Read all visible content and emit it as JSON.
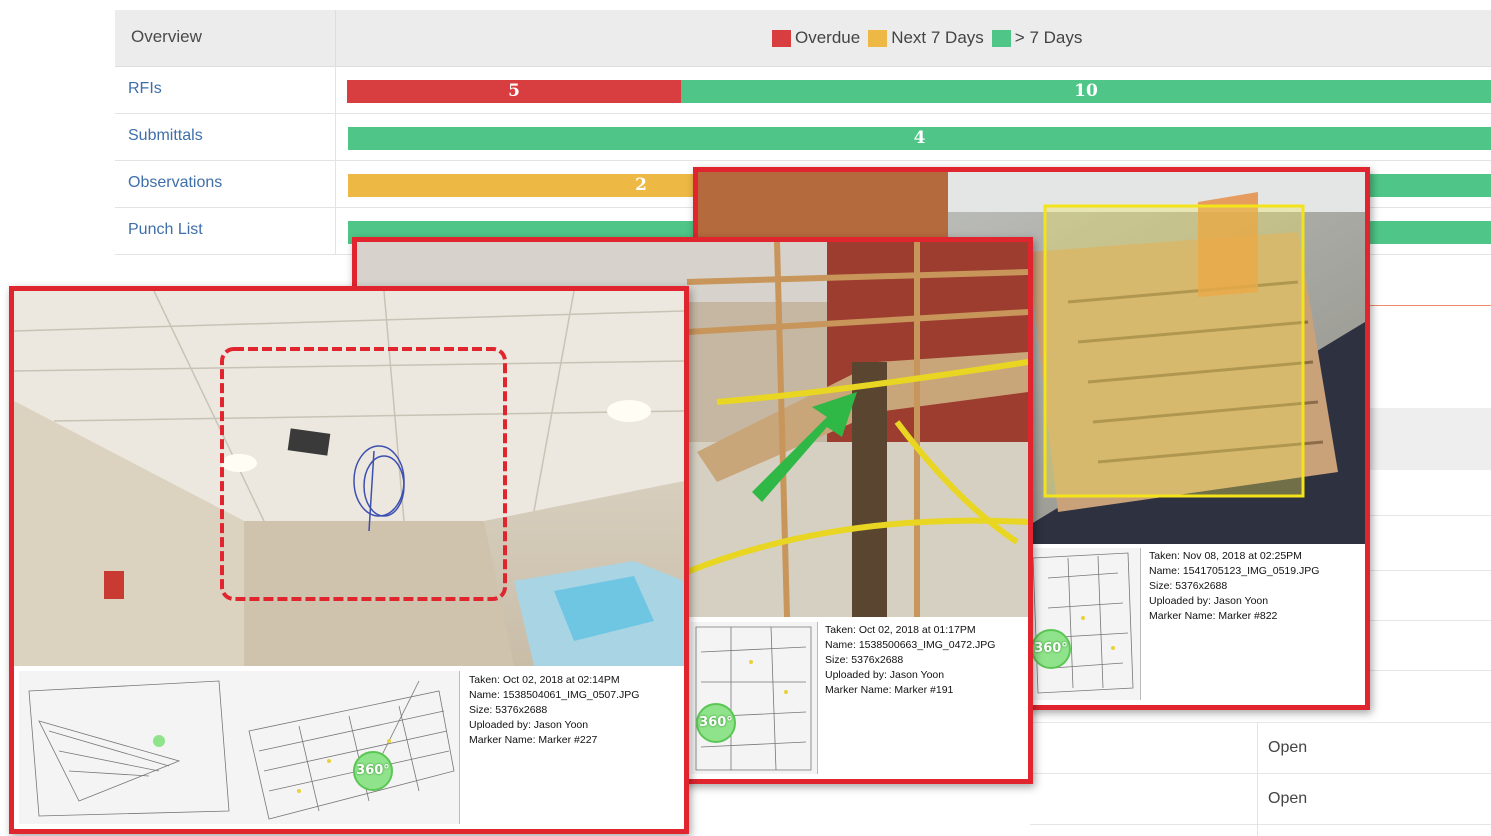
{
  "overview": {
    "title": "Overview",
    "legend": [
      {
        "label": "Overdue",
        "color": "#d83d3f"
      },
      {
        "label": "Next 7 Days",
        "color": "#eeb845"
      },
      {
        "label": "> 7 Days",
        "color": "#4fc687"
      }
    ],
    "rows": [
      {
        "label": "RFIs",
        "overdue": "5",
        "next7": "",
        "later": "10"
      },
      {
        "label": "Submittals",
        "overdue": "",
        "next7": "",
        "later": "4"
      },
      {
        "label": "Observations",
        "overdue": "",
        "next7": "2",
        "later": ""
      },
      {
        "label": "Punch List",
        "overdue": "",
        "next7": "",
        "later": ""
      }
    ]
  },
  "background_table": {
    "status_cells": [
      "Open",
      "Open"
    ]
  },
  "photos": [
    {
      "taken": "Taken: Oct 02, 2018 at 02:14PM",
      "name": "Name: 1538504061_IMG_0507.JPG",
      "size": "Size: 5376x2688",
      "uploaded_by": "Uploaded by: Jason Yoon",
      "marker": "Marker Name: Marker #227",
      "badge": "360°",
      "annotation": "red-cloud"
    },
    {
      "taken": "Taken: Oct 02, 2018 at 01:17PM",
      "name": "Name: 1538500663_IMG_0472.JPG",
      "size": "Size: 5376x2688",
      "uploaded_by": "Uploaded by: Jason Yoon",
      "marker": "Marker Name: Marker #191",
      "badge": "360°",
      "annotation": "green-arrow"
    },
    {
      "taken": "Taken: Nov 08, 2018 at 02:25PM",
      "name": "Name: 1541705123_IMG_0519.JPG",
      "size": "Size: 5376x2688",
      "uploaded_by": "Uploaded by: Jason Yoon",
      "marker": "Marker Name: Marker #822",
      "badge": "360°",
      "annotation": "yellow-rectangle"
    }
  ]
}
